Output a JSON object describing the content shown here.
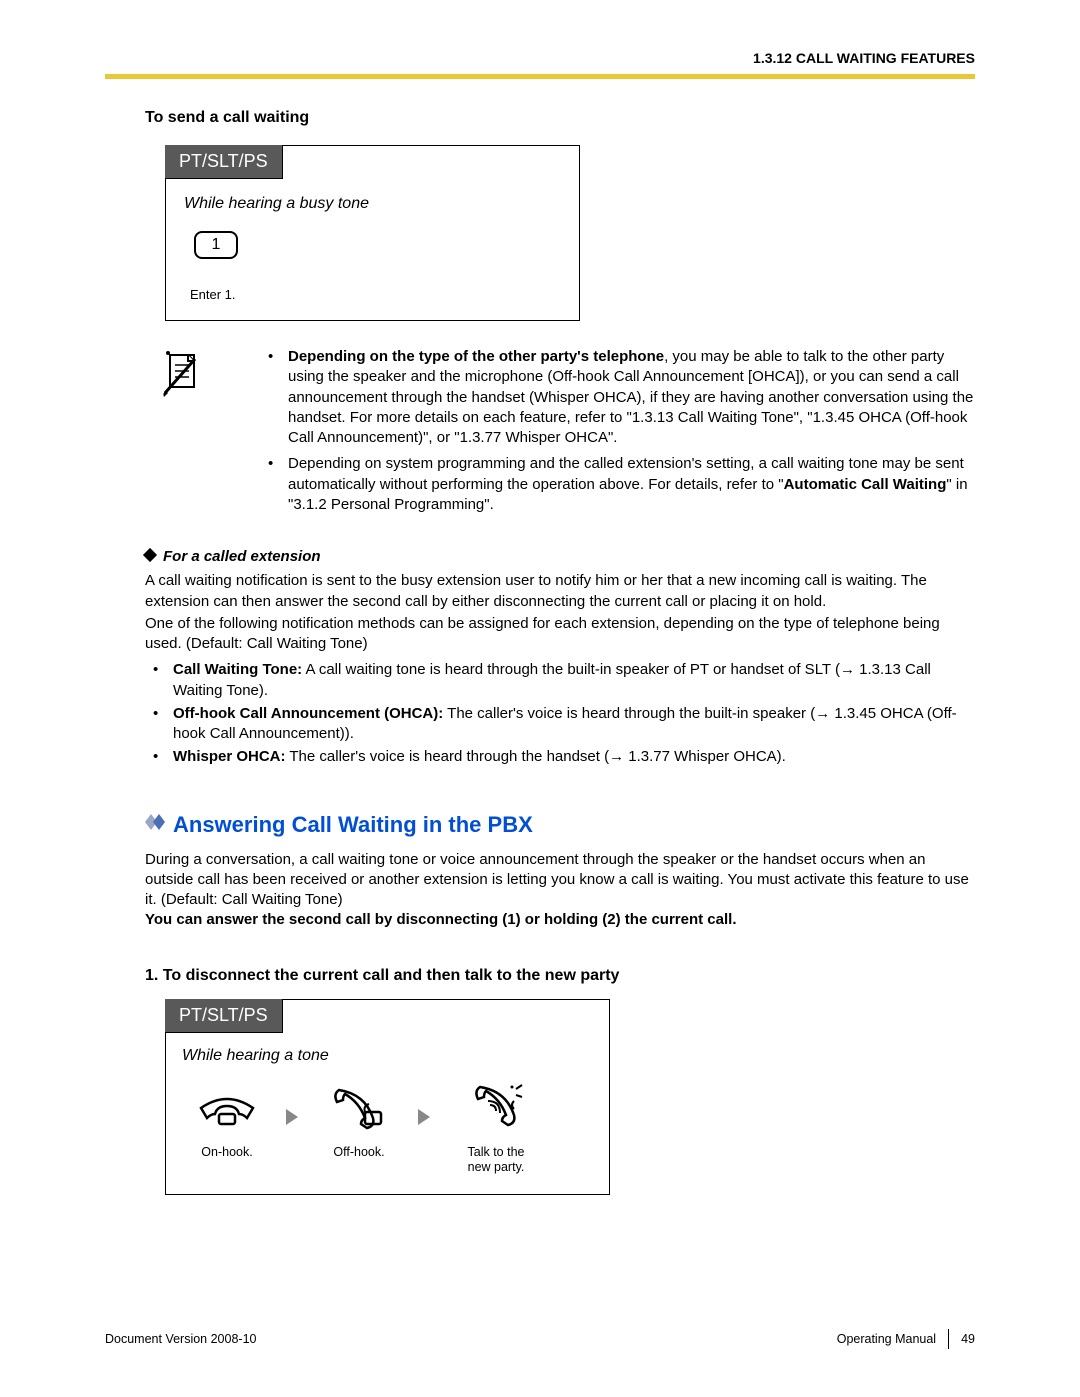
{
  "header": {
    "section": "1.3.12 CALL WAITING FEATURES"
  },
  "send": {
    "heading": "To send a call waiting",
    "tab": "PT/SLT/PS",
    "condition": "While hearing a busy tone",
    "key": "1",
    "instruction": "Enter 1."
  },
  "notes": {
    "item1_bold": "Depending on the type of the other party's telephone",
    "item1_rest": ", you may be able to talk to the other party using the speaker and the microphone (Off-hook Call Announcement [OHCA]), or you can send a call announcement through the handset (Whisper OHCA), if they are having another conversation using the handset. For more details on each feature, refer to \"1.3.13  Call Waiting Tone\", \"1.3.45  OHCA (Off-hook Call Announcement)\", or \"1.3.77  Whisper OHCA\".",
    "item2_pre": "Depending on system programming and the called extension's setting, a call waiting tone may be sent automatically without performing the operation above. For details, refer to \"",
    "item2_bold": "Automatic Call Waiting",
    "item2_post": "\" in \"3.1.2  Personal Programming\"."
  },
  "called": {
    "heading": "For a called extension",
    "p1": "A call waiting notification is sent to the busy extension user to notify him or her that a new incoming call is waiting. The extension can then answer the second call by either disconnecting the current call or placing it on hold.",
    "p2": "One of the following notification methods can be assigned for each extension, depending on the type of telephone being used. (Default: Call Waiting Tone)",
    "b1_bold": "Call Waiting Tone:",
    "b1_rest": " A call waiting tone is heard through the built-in speaker of PT or handset of SLT (→ 1.3.13  Call Waiting Tone).",
    "b2_bold": "Off-hook Call Announcement (OHCA):",
    "b2_rest": " The caller's voice is heard through the built-in speaker (→ 1.3.45  OHCA (Off-hook Call Announcement)).",
    "b3_bold": "Whisper OHCA:",
    "b3_rest": " The caller's voice is heard through the handset (→ 1.3.77  Whisper OHCA)."
  },
  "answer": {
    "heading": "Answering Call Waiting in the PBX",
    "p1": "During a conversation, a call waiting tone or voice announcement through the speaker or the handset occurs when an outside call has been received or another extension is letting you know a call is waiting. You must activate this feature to use it. (Default: Call Waiting Tone)",
    "p2_bold": "You can answer the second call by disconnecting (1) or holding (2) the current call.",
    "num_head": "1. To disconnect the current call and then talk to the new party",
    "tab": "PT/SLT/PS",
    "condition": "While hearing a tone",
    "step1": "On-hook.",
    "step2": "Off-hook.",
    "step3a": "Talk to the",
    "step3b": "new party."
  },
  "footer": {
    "left": "Document Version  2008-10",
    "right_label": "Operating Manual",
    "page": "49"
  }
}
